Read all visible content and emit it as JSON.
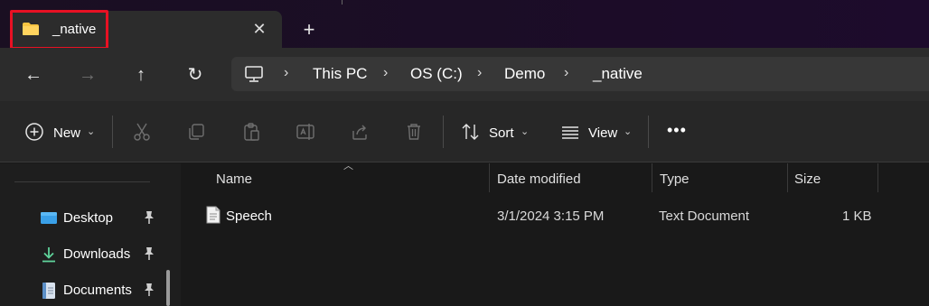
{
  "tab": {
    "title": "_native",
    "close_glyph": "✕",
    "new_tab_glyph": "+"
  },
  "nav": {
    "back_glyph": "←",
    "forward_glyph": "→",
    "up_glyph": "↑",
    "refresh_glyph": "↻"
  },
  "address": {
    "crumbs": [
      "This PC",
      "OS (C:)",
      "Demo",
      "_native"
    ],
    "separator": "›"
  },
  "toolbar": {
    "new_label": "New",
    "sort_label": "Sort",
    "view_label": "View",
    "caret": "⌄",
    "more_glyph": "•••"
  },
  "sidebar": {
    "items": [
      {
        "label": "Desktop",
        "icon": "desktop-icon"
      },
      {
        "label": "Downloads",
        "icon": "download-icon"
      },
      {
        "label": "Documents",
        "icon": "documents-icon"
      }
    ]
  },
  "columns": {
    "name": "Name",
    "date": "Date modified",
    "type": "Type",
    "size": "Size"
  },
  "files": [
    {
      "name": "Speech",
      "date": "3/1/2024 3:15 PM",
      "type": "Text Document",
      "size": "1 KB",
      "icon": "text-file-icon"
    }
  ],
  "colors": {
    "accent_highlight": "#e81123",
    "folder_yellow": "#f8c542",
    "desktop_blue": "#3aa0e8",
    "download_green": "#5fd39a"
  }
}
